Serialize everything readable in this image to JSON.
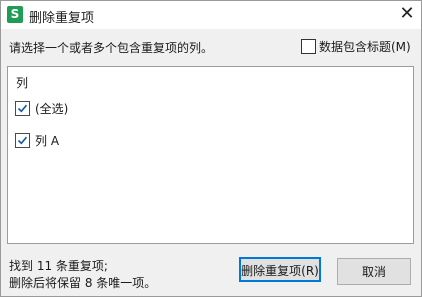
{
  "window": {
    "icon_letter": "S",
    "title": "删除重复项",
    "close_glyph": "✕"
  },
  "instruction": "请选择一个或者多个包含重复项的列。",
  "header_option": {
    "label": "数据包含标题(M)",
    "checked": false
  },
  "column_list": {
    "header": "列",
    "items": [
      {
        "label": "(全选)",
        "checked": true
      },
      {
        "label": "列 A",
        "checked": true
      }
    ]
  },
  "summary": {
    "line1": "找到 11 条重复项;",
    "line2": "删除后将保留 8 条唯一项。"
  },
  "buttons": {
    "delete": "删除重复项(R)",
    "cancel": "取消"
  },
  "colors": {
    "accent": "#0078d7",
    "app_icon": "#1f9d55",
    "checkmark": "#0c5ea8"
  }
}
